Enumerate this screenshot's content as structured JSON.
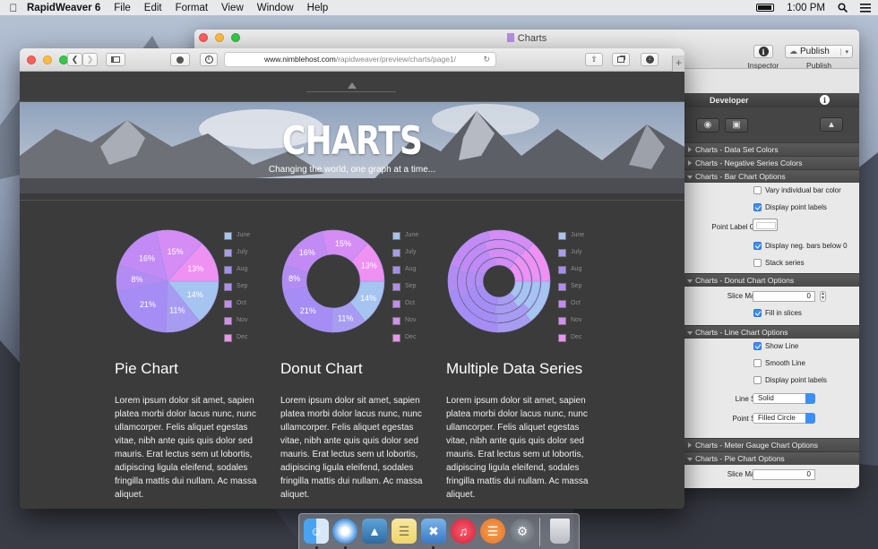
{
  "menubar": {
    "app_name": "RapidWeaver 6",
    "menus": [
      "File",
      "Edit",
      "Format",
      "View",
      "Window",
      "Help"
    ],
    "time": "1:00 PM"
  },
  "rw_window": {
    "title": "Charts",
    "inspector_label": "Inspector",
    "publish_button": "Publish",
    "publish_label": "Publish"
  },
  "developer_panel": {
    "header": "Developer",
    "sections": {
      "data_set_colors": "Charts - Data Set Colors",
      "negative_series_colors": "Charts - Negative Series Colors",
      "bar_chart_options": "Charts - Bar Chart Options",
      "donut_chart_options": "Charts - Donut Chart Options",
      "line_chart_options": "Charts - Line Chart Options",
      "meter_gauge_options": "Charts - Meter Gauge Chart Options",
      "pie_chart_options": "Charts - Pie Chart Options"
    },
    "bar": {
      "vary_color": "Vary individual bar color",
      "display_labels": "Display point labels",
      "point_label_color": "Point Label Color:",
      "display_neg_bars": "Display neg. bars below 0",
      "stack_series": "Stack series"
    },
    "donut": {
      "slice_margin_label": "Slice Margin:",
      "slice_margin_value": "0",
      "fill_in_slices": "Fill in slices"
    },
    "line": {
      "show_line": "Show Line",
      "smooth_line": "Smooth Line",
      "display_labels": "Display point labels",
      "line_style_label": "Line Style:",
      "line_style_value": "Solid",
      "point_style_label": "Point Style:",
      "point_style_value": "Filled Circle"
    },
    "pie": {
      "slice_margin_label": "Slice Margin:",
      "slice_margin_value": "0"
    }
  },
  "safari": {
    "url_host": "www.nimblehost.com",
    "url_path": "/rapidweaver/preview/charts/page1/"
  },
  "hero": {
    "title": "CHARTS",
    "subtitle": "Changing the world, one graph at a time..."
  },
  "legend": [
    "June",
    "July",
    "Aug",
    "Sep",
    "Oct",
    "Nov",
    "Dec"
  ],
  "colors": {
    "slices": [
      "#a5c4f0",
      "#a89cf2",
      "#a58df5",
      "#b38cf3",
      "#c28af4",
      "#d58cf5",
      "#ef90f3"
    ],
    "accent": "#3e8ef7"
  },
  "chart_data": [
    {
      "type": "pie",
      "categories": [
        "June",
        "July",
        "Aug",
        "Sep",
        "Oct",
        "Nov",
        "Dec"
      ],
      "values": [
        14,
        11,
        21,
        8,
        16,
        15,
        13
      ],
      "labels": [
        "14%",
        "11%",
        "21%",
        "8%",
        "16%",
        "15%",
        "13%"
      ],
      "title": "Pie Chart"
    },
    {
      "type": "donut",
      "categories": [
        "June",
        "July",
        "Aug",
        "Sep",
        "Oct",
        "Nov",
        "Dec"
      ],
      "values": [
        14,
        11,
        21,
        8,
        16,
        15,
        13
      ],
      "labels": [
        "14%",
        "11%",
        "21%",
        "8%",
        "16%",
        "15%",
        "13%"
      ],
      "title": "Donut Chart"
    },
    {
      "type": "donut",
      "categories": [
        "June",
        "July",
        "Aug",
        "Sep",
        "Oct",
        "Nov",
        "Dec"
      ],
      "series": [
        {
          "values": [
            14,
            11,
            21,
            8,
            16,
            15,
            13
          ]
        },
        {
          "values": [
            12,
            14,
            18,
            10,
            15,
            17,
            14
          ]
        },
        {
          "values": [
            15,
            12,
            19,
            9,
            14,
            16,
            15
          ]
        },
        {
          "values": [
            13,
            13,
            20,
            11,
            15,
            14,
            14
          ]
        }
      ],
      "title": "Multiple Data Series"
    }
  ],
  "columns": [
    {
      "title": "Pie Chart",
      "text": "Lorem ipsum dolor sit amet, sapien platea morbi dolor lacus nunc, nunc ullamcorper. Felis aliquet egestas vitae, nibh ante quis quis dolor sed mauris. Erat lectus sem ut lobortis, adipiscing ligula eleifend, sodales fringilla mattis dui nullam. Ac massa aliquet."
    },
    {
      "title": "Donut Chart",
      "text": "Lorem ipsum dolor sit amet, sapien platea morbi dolor lacus nunc, nunc ullamcorper. Felis aliquet egestas vitae, nibh ante quis quis dolor sed mauris. Erat lectus sem ut lobortis, adipiscing ligula eleifend, sodales fringilla mattis dui nullam. Ac massa aliquet."
    },
    {
      "title": "Multiple Data Series",
      "text": "Lorem ipsum dolor sit amet, sapien platea morbi dolor lacus nunc, nunc ullamcorper. Felis aliquet egestas vitae, nibh ante quis quis dolor sed mauris. Erat lectus sem ut lobortis, adipiscing ligula eleifend, sodales fringilla mattis dui nullam. Ac massa aliquet."
    }
  ],
  "dock": {
    "apps": [
      "finder-icon",
      "safari-icon",
      "preview-icon",
      "notes-icon",
      "xcode-icon",
      "itunes-icon",
      "ibooks-icon",
      "system-preferences-icon",
      "trash-icon"
    ]
  }
}
